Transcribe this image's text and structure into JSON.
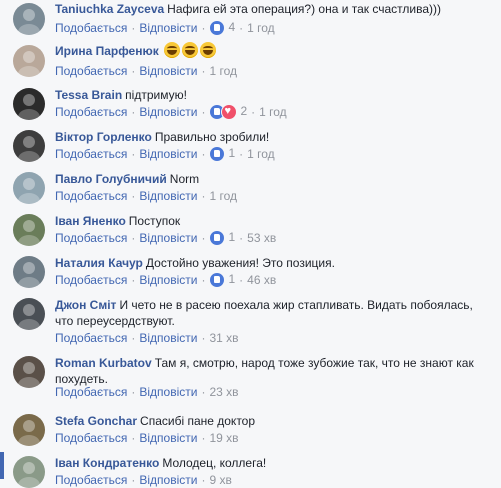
{
  "comments": [
    {
      "author": "Taniuchka Zayceva",
      "text": "Нафига ей эта операция?) она и так счастлива)))",
      "emoji_count": 0,
      "like": "Подобається",
      "reply": "Відповісти",
      "reactions": [
        "like"
      ],
      "reaction_count": "4",
      "time": "1 год",
      "avatar_color": "#7a8a95"
    },
    {
      "author": "Ирина Парфенюк",
      "text": "",
      "emoji_count": 3,
      "like": "Подобається",
      "reply": "Відповісти",
      "reactions": [],
      "reaction_count": "",
      "time": "1 год",
      "avatar_color": "#b9a89a"
    },
    {
      "author": "Tessa Brain",
      "text": "підтримую!",
      "emoji_count": 0,
      "like": "Подобається",
      "reply": "Відповісти",
      "reactions": [
        "like",
        "love"
      ],
      "reaction_count": "2",
      "time": "1 год",
      "avatar_color": "#2b2b2b"
    },
    {
      "author": "Віктор Горленко",
      "text": "Правильно зробили!",
      "emoji_count": 0,
      "like": "Подобається",
      "reply": "Відповісти",
      "reactions": [
        "like"
      ],
      "reaction_count": "1",
      "time": "1 год",
      "avatar_color": "#3d3d3d"
    },
    {
      "author": "Павло Голубничий",
      "text": "Norm",
      "emoji_count": 0,
      "like": "Подобається",
      "reply": "Відповісти",
      "reactions": [],
      "reaction_count": "",
      "time": "1 год",
      "avatar_color": "#8fa4b0"
    },
    {
      "author": "Іван Яненко",
      "text": "Поступок",
      "emoji_count": 0,
      "like": "Подобається",
      "reply": "Відповісти",
      "reactions": [
        "like"
      ],
      "reaction_count": "1",
      "time": "53 хв",
      "avatar_color": "#6a7d5a"
    },
    {
      "author": "Наталия Качур",
      "text": "Достойно уважения! Это позиция.",
      "emoji_count": 0,
      "like": "Подобається",
      "reply": "Відповісти",
      "reactions": [
        "like"
      ],
      "reaction_count": "1",
      "time": "46 хв",
      "avatar_color": "#6e7c86"
    },
    {
      "author": "Джон Сміт",
      "text": "И чето не в расею поехала жир стапливать. Видать побоялась, что переусердствуют.",
      "emoji_count": 0,
      "like": "Подобається",
      "reply": "Відповісти",
      "reactions": [],
      "reaction_count": "",
      "time": "31 хв",
      "avatar_color": "#4a4f55"
    },
    {
      "author": "Roman Kurbatov",
      "text": "Там я, смотрю, народ тоже зубожие так, что не знают как похудеть.",
      "emoji_count": 0,
      "like": "Подобається",
      "reply": "Відповісти",
      "reactions": [],
      "reaction_count": "",
      "time": "23 хв",
      "avatar_color": "#5a5048"
    },
    {
      "author": "Stefa Gonchar",
      "text": "Спасибі пане доктор",
      "emoji_count": 0,
      "like": "Подобається",
      "reply": "Відповісти",
      "reactions": [],
      "reaction_count": "",
      "time": "19 хв",
      "avatar_color": "#7a6a4a"
    },
    {
      "author": "Іван Кондратенко",
      "text": "Молодец, коллега!",
      "emoji_count": 0,
      "like": "Подобається",
      "reply": "Відповісти",
      "reactions": [],
      "reaction_count": "",
      "time": "9 хв",
      "avatar_color": "#8a9a88"
    }
  ]
}
